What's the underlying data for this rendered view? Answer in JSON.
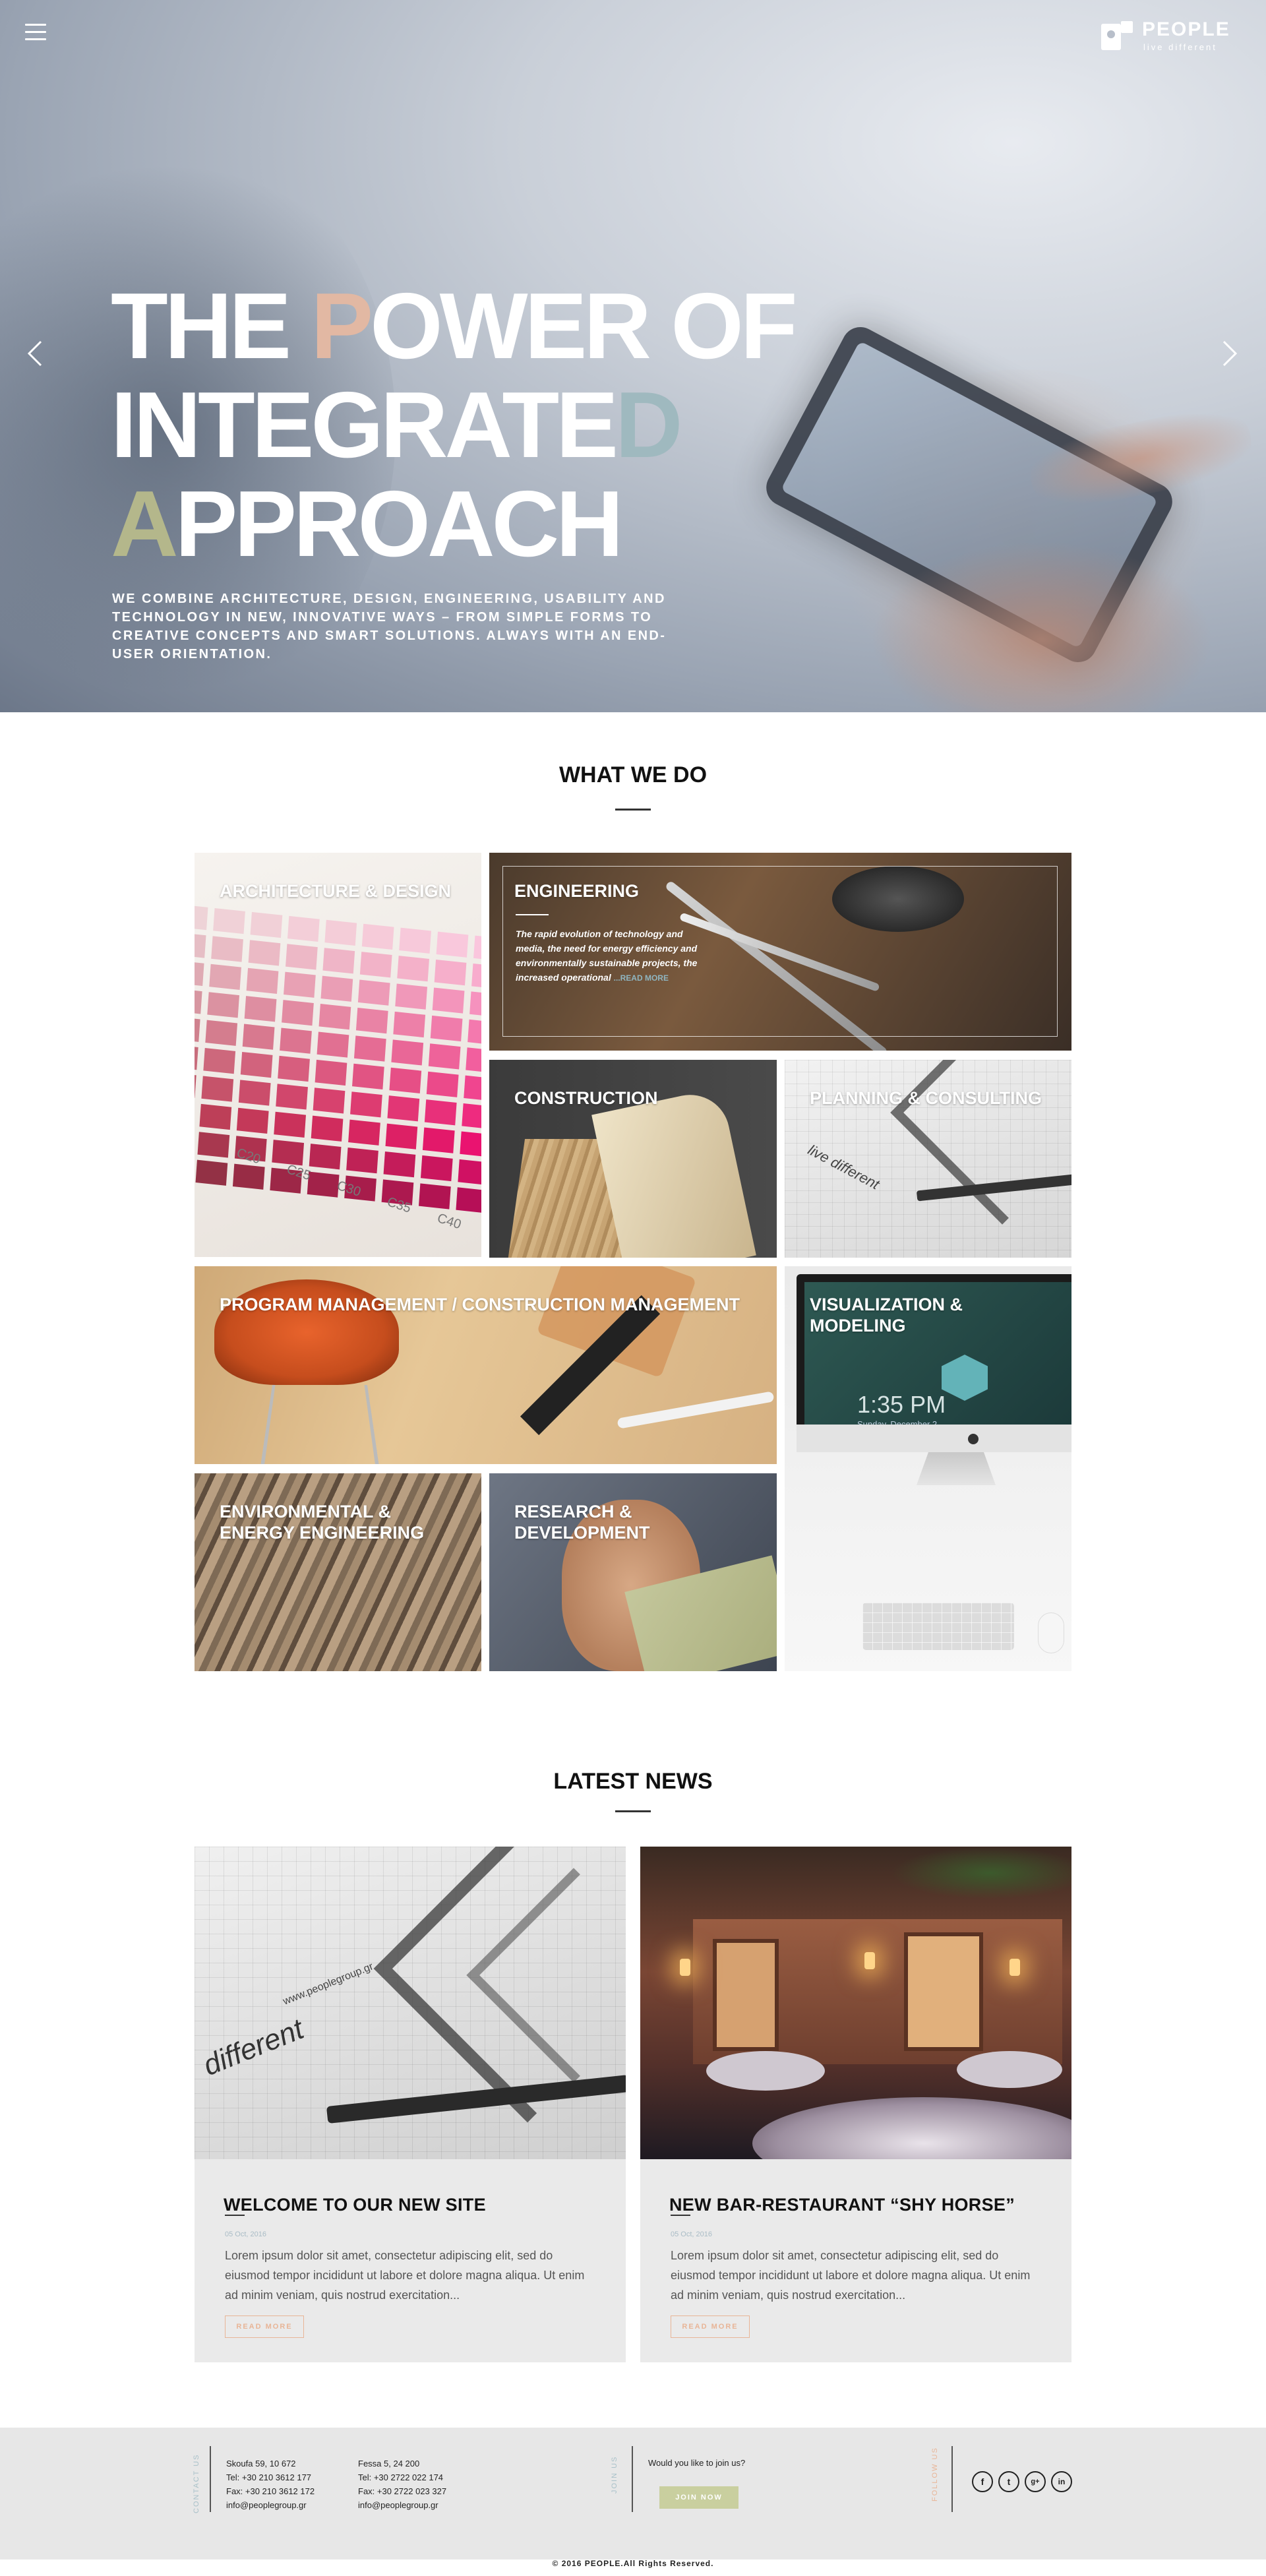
{
  "header": {
    "logo_name": "PEOPLE",
    "logo_tagline": "live different"
  },
  "hero": {
    "title_line1_a": "THE ",
    "title_line1_accent": "P",
    "title_line1_b": "OWER OF",
    "title_line2_a": "INTEGRATE",
    "title_line2_accent": "D",
    "title_line3_accent": "A",
    "title_line3_b": "PPROACH",
    "subtitle": "WE COMBINE ARCHITECTURE, DESIGN, ENGINEERING, USABILITY AND TECHNOLOGY IN NEW, INNOVATIVE WAYS – FROM SIMPLE FORMS TO CREATIVE CONCEPTS AND SMART SOLUTIONS. ALWAYS WITH AN END-USER ORIENTATION.",
    "accent_colors": [
      "#e2b8a3",
      "#9fb9bf",
      "#b4b78b"
    ]
  },
  "what_we_do": {
    "heading": "WHAT WE DO",
    "tiles": {
      "architecture": "ARCHITECTURE & DESIGN",
      "engineering": "ENGINEERING",
      "engineering_desc": "The rapid evolution of technology and media, the need for energy efficiency and environmentally sustainable projects, the increased operational ",
      "engineering_more": "...READ MORE",
      "construction": "CONSTRUCTION",
      "planning": "PLANNING & CONSULTING",
      "program": "PROGRAM MANAGEMENT / CONSTRUCTION MANAGEMENT",
      "visualization": "VISUALIZATION  & MODELING",
      "environmental": "ENVIRONMENTAL & ENERGY ENGINEERING",
      "research": "RESEARCH & DEVELOPMENT"
    },
    "swatch_labels": [
      "C20",
      "C25",
      "C30",
      "C35",
      "C40"
    ],
    "imac_time": "1:35 PM",
    "imac_date": "Sunday, December 2",
    "plan_scribble": "live different"
  },
  "latest_news": {
    "heading": "LATEST NEWS",
    "posts": [
      {
        "title": "WELCOME TO OUR NEW SITE",
        "date": "05 Oct, 2016",
        "body": "Lorem ipsum dolor sit amet, consectetur adipiscing elit, sed do eiusmod tempor incididunt ut labore et dolore magna aliqua. Ut enim ad minim veniam, quis nostrud exercitation...",
        "button": "READ MORE",
        "image_word": "different",
        "image_url": "www.peoplegroup.gr"
      },
      {
        "title": "NEW BAR-RESTAURANT “SHY HORSE”",
        "date": "05 Oct, 2016",
        "body": "Lorem ipsum dolor sit amet, consectetur adipiscing elit, sed do eiusmod tempor incididunt ut labore et dolore magna aliqua. Ut enim ad minim veniam, quis nostrud exercitation...",
        "button": "READ MORE"
      }
    ]
  },
  "footer": {
    "contact_label": "CONTACT US",
    "address1": [
      "Skoufa 59, 10 672",
      "Tel: +30 210 3612 177",
      "Fax: +30 210 3612 172",
      "info@peoplegroup.gr"
    ],
    "address2": [
      "Fessa 5, 24 200",
      "Tel: +30 2722 022 174",
      "Fax: +30 2722 023 327",
      "info@peoplegroup.gr"
    ],
    "join_label": "JOIN US",
    "join_question": "Would you like to join us?",
    "join_button": "JOIN NOW",
    "follow_label": "FOLLOW US",
    "socials": [
      "f",
      "t",
      "g+",
      "in"
    ],
    "copyright": "© 2016 PEOPLE.All Rights Reserved."
  }
}
